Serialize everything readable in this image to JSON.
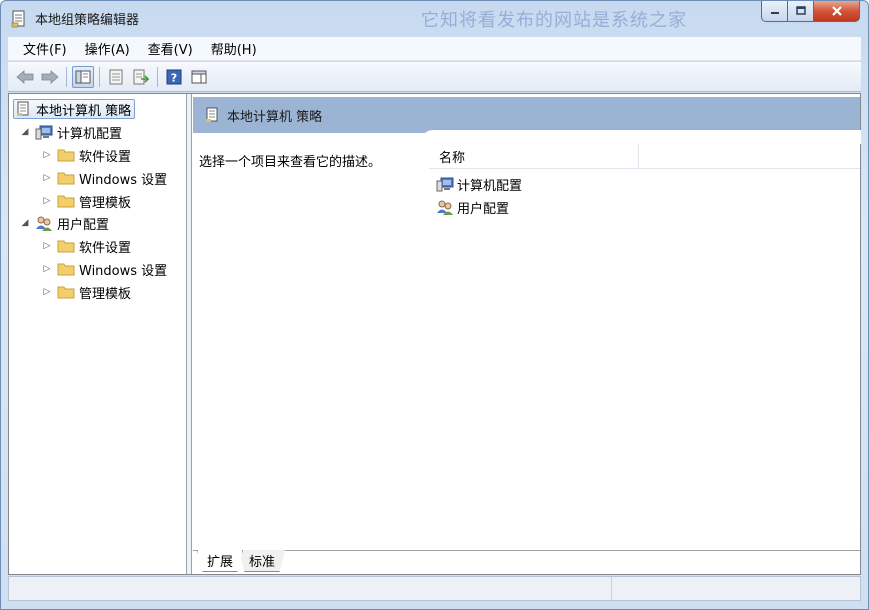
{
  "window": {
    "title": "本地组策略编辑器",
    "watermark": "它知将看发布的网站是系统之家"
  },
  "menu": {
    "items": [
      "文件(F)",
      "操作(A)",
      "查看(V)",
      "帮助(H)"
    ]
  },
  "tree": {
    "root": "本地计算机 策略",
    "computer": {
      "label": "计算机配置",
      "children": [
        "软件设置",
        "Windows 设置",
        "管理模板"
      ]
    },
    "user": {
      "label": "用户配置",
      "children": [
        "软件设置",
        "Windows 设置",
        "管理模板"
      ]
    }
  },
  "detail": {
    "header": "本地计算机 策略",
    "description": "选择一个项目来查看它的描述。",
    "column_name": "名称",
    "items": [
      "计算机配置",
      "用户配置"
    ]
  },
  "tabs": [
    "扩展",
    "标准"
  ],
  "colors": {
    "header_bg": "#9cb4d4",
    "folder": "#f2cf6c",
    "close_button": "#c9442a"
  }
}
